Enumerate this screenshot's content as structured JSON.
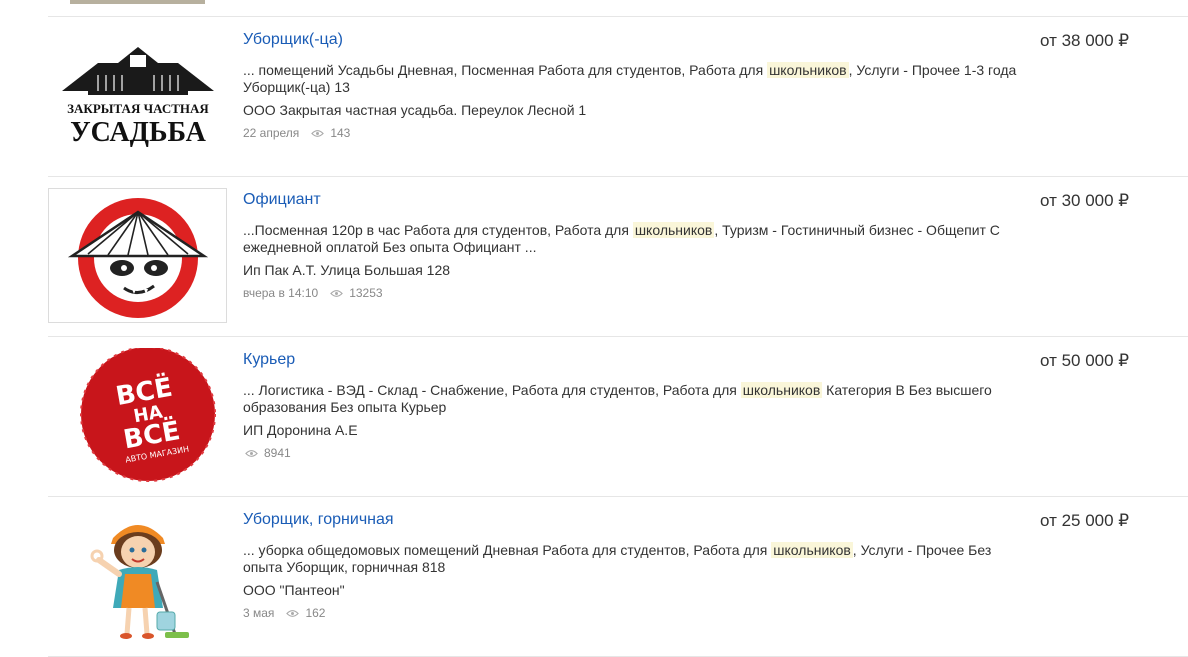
{
  "listings": [
    {
      "title": "Уборщик(-ца)",
      "snippet_before": "... помещений Усадьбы Дневная, Посменная Работа для студентов, Работа для ",
      "highlight": "школьников",
      "snippet_after": ", Услуги - Прочее 1-3 года Уборщик(-ца) 13",
      "company": "ООО Закрытая частная усадьба. Переулок Лесной 1",
      "date": "22 апреля",
      "views": "143",
      "salary": "от 38 000 ₽",
      "logo": {
        "line1": "ЗАКРЫТАЯ ЧАСТНАЯ",
        "line2": "УСАДЬБА",
        "icon": "manor-logo"
      }
    },
    {
      "title": "Официант",
      "snippet_before": "...Посменная 120р в час Работа для студентов, Работа для ",
      "highlight": "школьников",
      "snippet_after": ", Туризм - Гостиничный бизнес - Общепит С ежедневной оплатой Без опыта Официант ...",
      "company": "Ип Пак А.Т. Улица Большая 128",
      "date": "вчера в 14:10",
      "views": "13253",
      "salary": "от 30 000 ₽",
      "logo": {
        "icon": "panda-conical-hat-logo"
      }
    },
    {
      "title": "Курьер",
      "snippet_before": "... Логистика - ВЭД - Склад - Снабжение, Работа для студентов, Работа для ",
      "highlight": "школьников",
      "snippet_after": " Категория В Без высшего образования Без опыта Курьер",
      "company": "ИП Доронина А.Е",
      "date": "",
      "views": "8941",
      "salary": "от 50 000 ₽",
      "logo": {
        "line1": "ВСЁ",
        "line2": "НА",
        "line3": "ВСЁ",
        "line4": "АВТО МАГАЗИН",
        "icon": "auto-shop-logo"
      }
    },
    {
      "title": "Уборщик, горничная",
      "snippet_before": "... уборка общедомовых помещений Дневная Работа для студентов, Работа для ",
      "highlight": "школьников",
      "snippet_after": ", Услуги - Прочее Без опыта Уборщик, горничная 818",
      "company": "ООО \"Пантеон\"",
      "date": "3 мая",
      "views": "162",
      "salary": "от 25 000 ₽",
      "logo": {
        "icon": "cleaning-lady-logo"
      }
    }
  ],
  "colors": {
    "link": "#1a5cb6",
    "highlight": "#faf6d9",
    "meta": "#888888",
    "divider": "#e6e6e6"
  }
}
